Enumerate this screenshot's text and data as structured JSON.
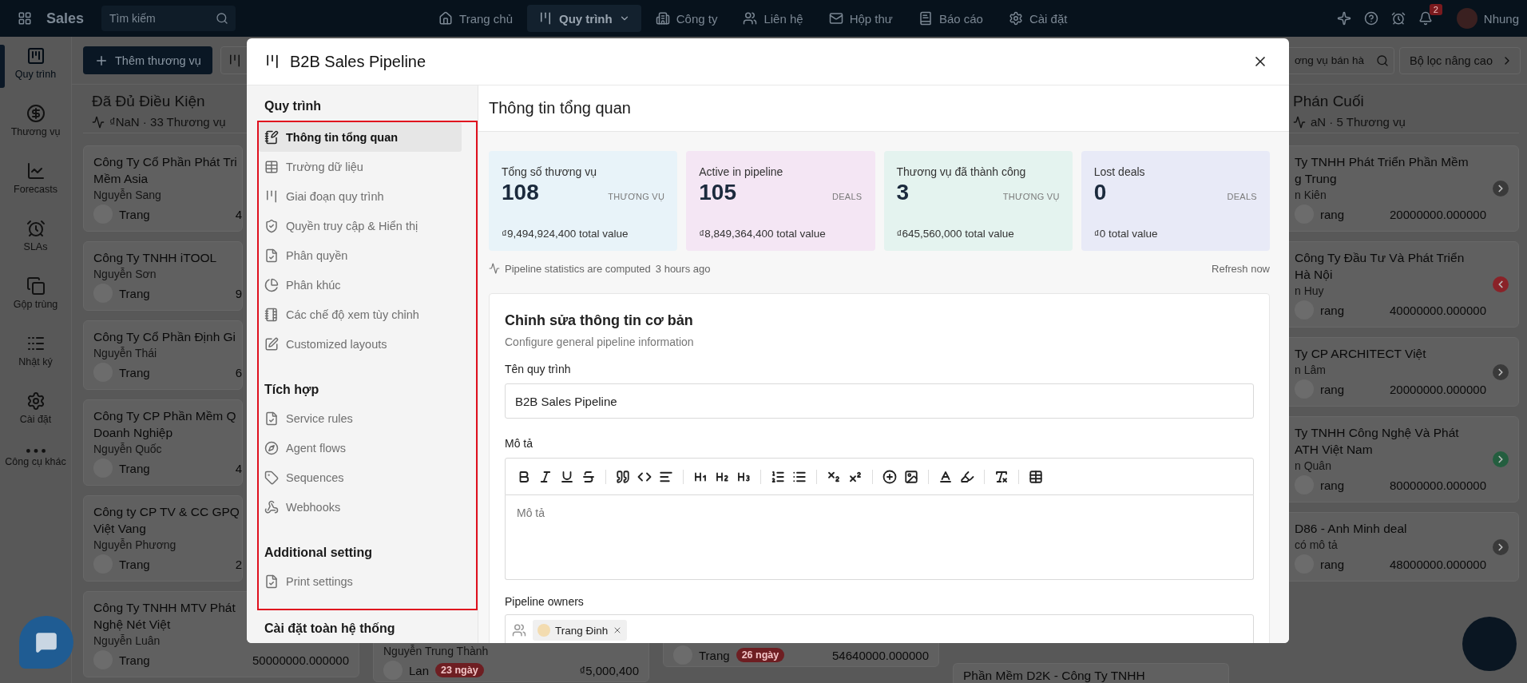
{
  "top_bar": {
    "app_name": "Sales",
    "search": {
      "placeholder": "Tìm kiếm"
    },
    "nav": [
      {
        "label": "Trang chủ",
        "selected": false
      },
      {
        "label": "Quy trình",
        "selected": true
      },
      {
        "label": "Công ty",
        "selected": false
      },
      {
        "label": "Liên hệ",
        "selected": false
      },
      {
        "label": "Hộp thư",
        "selected": false
      },
      {
        "label": "Báo cáo",
        "selected": false
      },
      {
        "label": "Cài đặt",
        "selected": false
      }
    ],
    "notification_count": "2",
    "user_name": "Nhung"
  },
  "side_rail": [
    {
      "label": "Quy trình",
      "selected": true
    },
    {
      "label": "Thương vụ",
      "selected": false
    },
    {
      "label": "Forecasts",
      "selected": false
    },
    {
      "label": "SLAs",
      "selected": false
    },
    {
      "label": "Gộp trùng",
      "selected": false
    },
    {
      "label": "Nhật ký",
      "selected": false
    },
    {
      "label": "Cài đặt",
      "selected": false
    },
    {
      "label": "Công cụ khác",
      "selected": false
    }
  ],
  "board": {
    "add_button": "Thêm thương vụ",
    "search": {
      "placeholder": "ơng vụ bán hà"
    },
    "filter_button": "Bộ lọc nâng cao",
    "columns": [
      {
        "title": "Đã Đủ Điều Kiện",
        "summary": "₫NaN · 33 Thương vụ",
        "cards": [
          {
            "title_lines": [
              "Công Ty Cổ Phần Phát Tri",
              "Mềm Asia"
            ],
            "contact": "Nguyễn Sang",
            "owner": "Trang",
            "amount": "4"
          },
          {
            "title_lines": [
              "Công Ty TNHH iTOOL"
            ],
            "contact": "Nguyễn Sơn",
            "owner": "Trang",
            "amount": "9"
          },
          {
            "title_lines": [
              "Công Ty Cổ Phần Định Gi"
            ],
            "contact": "Nguyễn Thái",
            "owner": "Trang",
            "amount": "6"
          },
          {
            "title_lines": [
              "Công Ty CP Phần Mềm Q",
              "Doanh Nghiệp"
            ],
            "contact": "Nguyễn Quốc",
            "owner": "Trang",
            "amount": "4"
          },
          {
            "title_lines": [
              "Công ty CP TV & CC GPQ",
              "Việt Vang"
            ],
            "contact": "Nguyễn Phương",
            "owner": "Trang",
            "amount": "2"
          },
          {
            "title_lines": [
              "Công Ty TNHH MTV Phát",
              "Nghệ Nét Việt"
            ],
            "contact": "Nguyễn Luân",
            "owner": "Trang",
            "amount": "50000000.000000"
          }
        ]
      },
      {
        "cards": [
          {
            "contact": "Nguyễn Trung Thành",
            "owner": "Lan",
            "age": "23 ngày",
            "amount": "₫5,000,400"
          }
        ]
      },
      {
        "cards": [
          {
            "owner": "Trang",
            "age": "26 ngày",
            "amount": "54640000.000000"
          }
        ]
      },
      {
        "cards": [
          {
            "title_lines": [
              "Phần Mềm D2K - Công Ty TNHH"
            ]
          }
        ]
      },
      {
        "title": "Phán Cuối",
        "summary": "aN · 5 Thương vụ",
        "cards": [
          {
            "title_lines": [
              "Ty TNHH Phát Triển Phần Mềm",
              "g Trung"
            ],
            "contact": "n Kiên",
            "owner": "rang",
            "amount": "20000000.000000",
            "arrow": {
              "points_left": false,
              "color": "#3a3a3a"
            }
          },
          {
            "title_lines": [
              "Công Ty Đầu Tư Và Phát Triển",
              "Hà Nội"
            ],
            "contact": "n Huy",
            "owner": "rang",
            "amount": "40000000.000000",
            "arrow": {
              "points_left": true,
              "color": "#8a2228"
            }
          },
          {
            "title_lines": [
              "Ty CP ARCHITECT Việt"
            ],
            "contact": "n Lâm",
            "owner": "rang",
            "amount": "20000000.000000",
            "arrow": {
              "points_left": false,
              "color": "#3a3a3a"
            }
          },
          {
            "title_lines": [
              "Ty TNHH Công Nghệ Và Phát",
              "ATH Việt Nam"
            ],
            "contact": "n Quân",
            "owner": "rang",
            "amount": "80000000.000000",
            "arrow": {
              "points_left": false,
              "color": "#245e3f"
            }
          },
          {
            "title_lines": [
              "D86 - Anh Minh deal"
            ],
            "contact": "có mô tả",
            "owner": "rang",
            "amount": "48000000.000000",
            "arrow": {
              "points_left": false,
              "color": "#3a3a3a"
            }
          }
        ]
      }
    ]
  },
  "modal": {
    "title": "B2B Sales Pipeline",
    "nav": [
      {
        "title": "Quy trình",
        "items": [
          {
            "label": "Thông tin tổng quan",
            "selected": true
          },
          {
            "label": "Trường dữ liệu",
            "selected": false
          },
          {
            "label": "Giai đoạn quy trình",
            "selected": false
          },
          {
            "label": "Quyền truy cập & Hiển thị",
            "selected": false
          },
          {
            "label": "Phân quyền",
            "selected": false
          },
          {
            "label": "Phân khúc",
            "selected": false
          },
          {
            "label": "Các chế độ xem tùy chỉnh",
            "selected": false
          },
          {
            "label": "Customized layouts",
            "selected": false
          }
        ]
      },
      {
        "title": "Tích hợp",
        "items": [
          {
            "label": "Service rules",
            "selected": false
          },
          {
            "label": "Agent flows",
            "selected": false
          },
          {
            "label": "Sequences",
            "selected": false
          },
          {
            "label": "Webhooks",
            "selected": false
          }
        ]
      },
      {
        "title": "Additional setting",
        "items": [
          {
            "label": "Print settings",
            "selected": false
          }
        ]
      },
      {
        "title": "Cài đặt toàn hệ thống"
      }
    ],
    "page_title": "Thông tin tổng quan",
    "stats": [
      {
        "label": "Tổng số thương vụ",
        "value": "108",
        "unit": "THƯƠNG VỤ",
        "total": "₫9,494,924,400 total value",
        "color": "#e8f3f9"
      },
      {
        "label": "Active in pipeline",
        "value": "105",
        "unit": "DEALS",
        "total": "₫8,849,364,400 total value",
        "color": "#f4e6f4"
      },
      {
        "label": "Thương vụ đã thành công",
        "value": "3",
        "unit": "THƯƠNG VỤ",
        "total": "₫645,560,000 total value",
        "color": "#e4f3ef"
      },
      {
        "label": "Lost deals",
        "value": "0",
        "unit": "DEALS",
        "total": "₫0 total value",
        "color": "#e8eaf7"
      }
    ],
    "stats_note": "Pipeline statistics are computed",
    "stats_updated": "3 hours ago",
    "refresh": "Refresh now",
    "form": {
      "title": "Chỉnh sửa thông tin cơ bản",
      "subtitle": "Configure general pipeline information",
      "name_label": "Tên quy trình",
      "name_value": "B2B Sales Pipeline",
      "description_label": "Mô tả",
      "description_placeholder": "Mô tả",
      "owners_label": "Pipeline owners",
      "owners": [
        "Trang Đinh"
      ]
    }
  }
}
